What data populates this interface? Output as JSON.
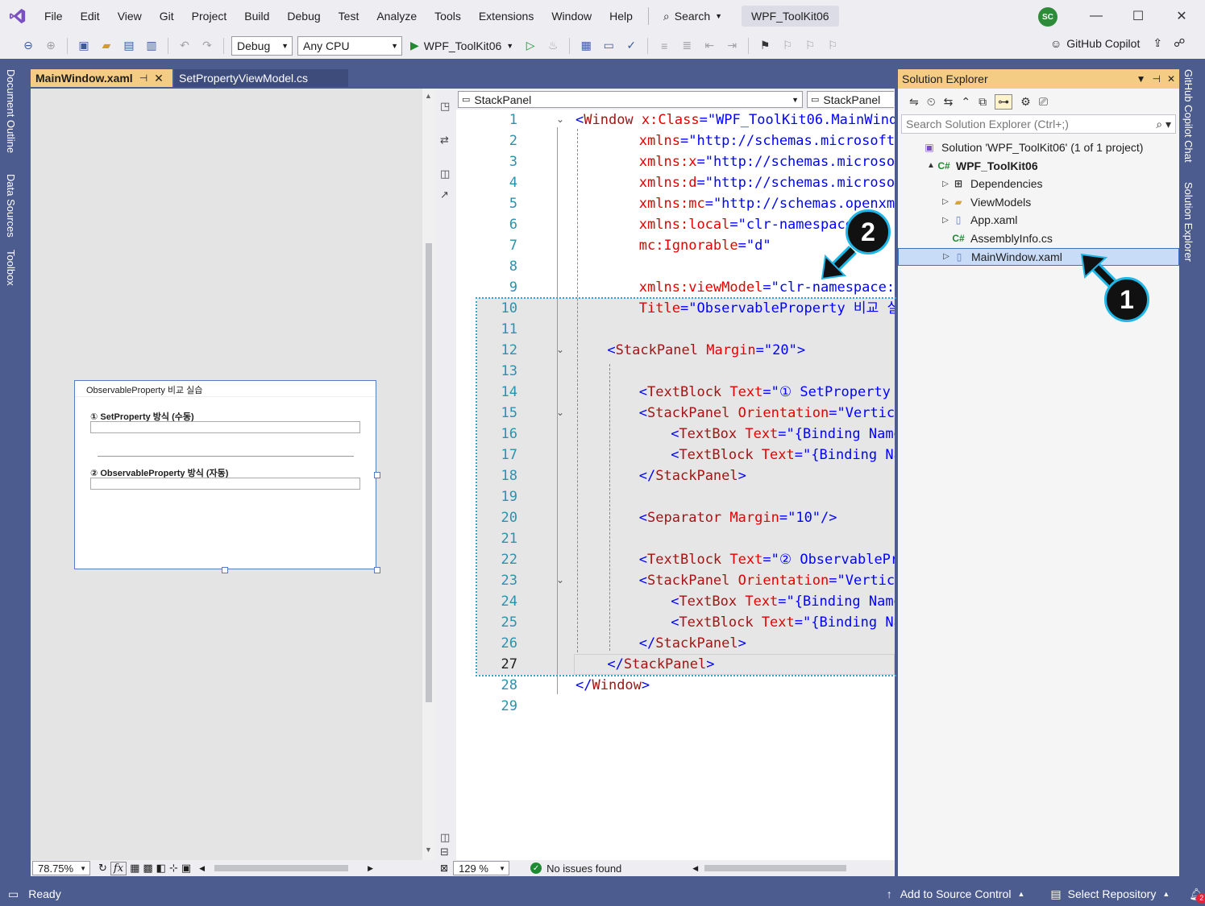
{
  "menubar": {
    "items": [
      "File",
      "Edit",
      "View",
      "Git",
      "Project",
      "Build",
      "Debug",
      "Test",
      "Analyze",
      "Tools",
      "Extensions",
      "Window",
      "Help"
    ],
    "search_label": "Search",
    "solution_name": "WPF_ToolKit06",
    "user_initials": "SC"
  },
  "toolbar": {
    "config": "Debug",
    "platform": "Any CPU",
    "run_target": "WPF_ToolKit06",
    "copilot_label": "GitHub Copilot"
  },
  "left_tabs": [
    "Document Outline",
    "Data Sources",
    "Toolbox"
  ],
  "right_tabs": [
    "GitHub Copilot Chat",
    "Solution Explorer"
  ],
  "doc_tabs": [
    {
      "label": "MainWindow.xaml",
      "active": true
    },
    {
      "label": "SetPropertyViewModel.cs",
      "active": false
    }
  ],
  "designer": {
    "window_title": "ObservableProperty 비교 실습",
    "label1": "① SetProperty 방식 (수동)",
    "label2": "② ObservableProperty 방식 (자동)",
    "zoom": "78.75%",
    "fx_label": "fx"
  },
  "editor": {
    "nav_left": "StackPanel",
    "nav_right": "StackPanel",
    "zoom": "129 %",
    "issues": "No issues found",
    "current_line": 27,
    "line_numbers": [
      1,
      2,
      3,
      4,
      5,
      6,
      7,
      8,
      9,
      10,
      11,
      12,
      13,
      14,
      15,
      16,
      17,
      18,
      19,
      20,
      21,
      22,
      23,
      24,
      25,
      26,
      27,
      28,
      29
    ],
    "lines": [
      {
        "ln": 1,
        "indent": 0,
        "text": "<Window x:Class=\"WPF_ToolKit06.MainWindo"
      },
      {
        "ln": 2,
        "indent": 4,
        "text": "xmlns=\"http://schemas.microsoft."
      },
      {
        "ln": 3,
        "indent": 4,
        "text": "xmlns:x=\"http://schemas.microsof"
      },
      {
        "ln": 4,
        "indent": 4,
        "text": "xmlns:d=\"http://schemas.microsof"
      },
      {
        "ln": 5,
        "indent": 4,
        "text": "xmlns:mc=\"http://schemas.openxml"
      },
      {
        "ln": 6,
        "indent": 4,
        "text": "xmlns:local=\"clr-namespace"
      },
      {
        "ln": 7,
        "indent": 4,
        "text": "mc:Ignorable=\"d\""
      },
      {
        "ln": 8,
        "indent": 0,
        "text": ""
      },
      {
        "ln": 9,
        "indent": 4,
        "text": "xmlns:viewModel=\"clr-namespace:W"
      },
      {
        "ln": 10,
        "indent": 4,
        "text": "Title=\"ObservableProperty 비교 실"
      },
      {
        "ln": 11,
        "indent": 0,
        "text": ""
      },
      {
        "ln": 12,
        "indent": 2,
        "text": "<StackPanel Margin=\"20\">"
      },
      {
        "ln": 13,
        "indent": 0,
        "text": ""
      },
      {
        "ln": 14,
        "indent": 4,
        "text": "<TextBlock Text=\"① SetProperty"
      },
      {
        "ln": 15,
        "indent": 4,
        "text": "<StackPanel Orientation=\"Vertica"
      },
      {
        "ln": 16,
        "indent": 6,
        "text": "<TextBox Text=\"{Binding Name"
      },
      {
        "ln": 17,
        "indent": 6,
        "text": "<TextBlock Text=\"{Binding Na"
      },
      {
        "ln": 18,
        "indent": 4,
        "text": "</StackPanel>"
      },
      {
        "ln": 19,
        "indent": 0,
        "text": ""
      },
      {
        "ln": 20,
        "indent": 4,
        "text": "<Separator Margin=\"10\"/>"
      },
      {
        "ln": 21,
        "indent": 0,
        "text": ""
      },
      {
        "ln": 22,
        "indent": 4,
        "text": "<TextBlock Text=\"② ObservablePr"
      },
      {
        "ln": 23,
        "indent": 4,
        "text": "<StackPanel Orientation=\"Vertica"
      },
      {
        "ln": 24,
        "indent": 6,
        "text": "<TextBox Text=\"{Binding Name"
      },
      {
        "ln": 25,
        "indent": 6,
        "text": "<TextBlock Text=\"{Binding Na"
      },
      {
        "ln": 26,
        "indent": 4,
        "text": "</StackPanel>"
      },
      {
        "ln": 27,
        "indent": 2,
        "text": "</StackPanel>"
      },
      {
        "ln": 28,
        "indent": 0,
        "text": "</Window>"
      },
      {
        "ln": 29,
        "indent": 0,
        "text": ""
      }
    ]
  },
  "solution_explorer": {
    "title": "Solution Explorer",
    "search_placeholder": "Search Solution Explorer (Ctrl+;)",
    "items": [
      {
        "label": "Solution 'WPF_ToolKit06' (1 of 1 project)",
        "level": 0,
        "arrow": "",
        "icon": "solution-icon"
      },
      {
        "label": "WPF_ToolKit06",
        "level": 1,
        "arrow": "▲",
        "icon": "csharp-project-icon",
        "bold": true
      },
      {
        "label": "Dependencies",
        "level": 2,
        "arrow": "▷",
        "icon": "dependencies-icon"
      },
      {
        "label": "ViewModels",
        "level": 2,
        "arrow": "▷",
        "icon": "folder-icon"
      },
      {
        "label": "App.xaml",
        "level": 2,
        "arrow": "▷",
        "icon": "xaml-file-icon"
      },
      {
        "label": "AssemblyInfo.cs",
        "level": 2,
        "arrow": "",
        "icon": "csharp-file-icon"
      },
      {
        "label": "MainWindow.xaml",
        "level": 2,
        "arrow": "▷",
        "icon": "xaml-file-icon",
        "selected": true
      }
    ]
  },
  "statusbar": {
    "ready": "Ready",
    "source_control": "Add to Source Control",
    "repository": "Select Repository",
    "notifications": "2"
  },
  "callouts": [
    "1",
    "2"
  ],
  "colors": {
    "frame_blue": "#4d5c8f",
    "active_tab": "#f5cc84",
    "highlight_border": "#2aa7d8",
    "xml_tag": "#a31515",
    "xml_attr": "#e50000",
    "xml_value": "#0000ff",
    "line_number": "#2b91af"
  }
}
